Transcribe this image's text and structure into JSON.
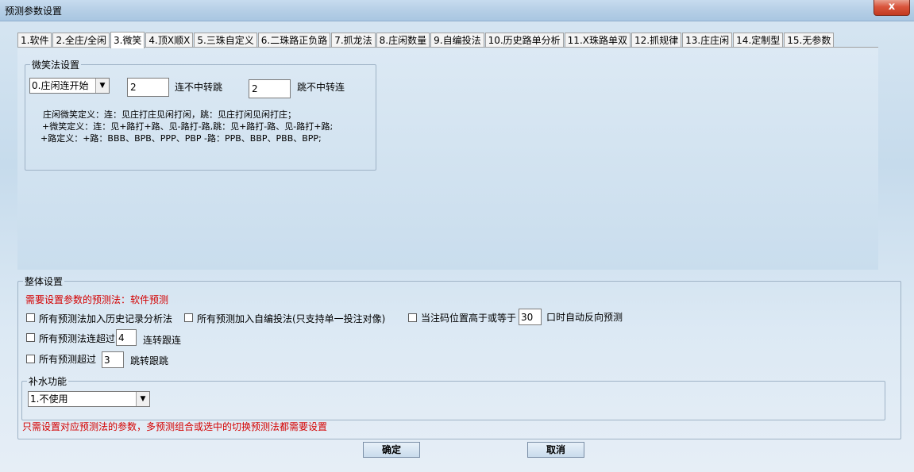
{
  "window": {
    "title": "预测参数设置",
    "close_label": "x",
    "background_text_1": "",
    "background_text_2": ""
  },
  "tabs": [
    {
      "label": "1.软件"
    },
    {
      "label": "2.全庄/全闲"
    },
    {
      "label": "3.微笑",
      "active": true
    },
    {
      "label": "4.顶X顺X"
    },
    {
      "label": "5.三珠自定义"
    },
    {
      "label": "6.二珠路正负路"
    },
    {
      "label": "7.抓龙法"
    },
    {
      "label": "8.庄闲数量"
    },
    {
      "label": "9.自编投法"
    },
    {
      "label": "10.历史路单分析"
    },
    {
      "label": "11.X珠路单双"
    },
    {
      "label": "12.抓规律"
    },
    {
      "label": "13.庄庄闲"
    },
    {
      "label": "14.定制型"
    },
    {
      "label": "15.无参数"
    }
  ],
  "smile": {
    "group_title": "微笑法设置",
    "start_select": "0.庄闲连开始",
    "lian_value": "2",
    "lian_label": "连不中转跳",
    "tiao_value": "2",
    "tiao_label": "跳不中转连",
    "desc_line1": "庄闲微笑定义：连：见庄打庄见闲打闲，跳：见庄打闲见闲打庄；",
    "desc_line2": "+微笑定义：连：见+路打+路、见-路打-路,跳：见+路打-路、见-路打+路;",
    "desc_line3": "+路定义：+路：BBB、BPB、PPP、PBP -路：PPB、BBP、PBB、BPP;"
  },
  "overall": {
    "group_title": "整体设置",
    "notice": "需要设置参数的预测法：软件预测",
    "opt_history": "所有预测法加入历史记录分析法",
    "opt_custom": "所有预测加入自编投法(只支持单一投注对像)",
    "opt_reverse_prefix": "当注码位置高于或等于",
    "opt_reverse_value": "30",
    "opt_reverse_suffix": "口时自动反向预测",
    "opt_lian_prefix": "所有预测法连超过",
    "opt_lian_value": "4",
    "opt_lian_suffix": "连转跟连",
    "opt_tiao_prefix": "所有预测超过",
    "opt_tiao_value": "3",
    "opt_tiao_suffix": "跳转跟跳",
    "water_group_title": "补水功能",
    "water_select": "1.不使用",
    "footer_notice": "只需设置对应预测法的参数，多预测组合或选中的切换预测法都需要设置"
  },
  "buttons": {
    "ok": "确定",
    "cancel": "取消"
  }
}
